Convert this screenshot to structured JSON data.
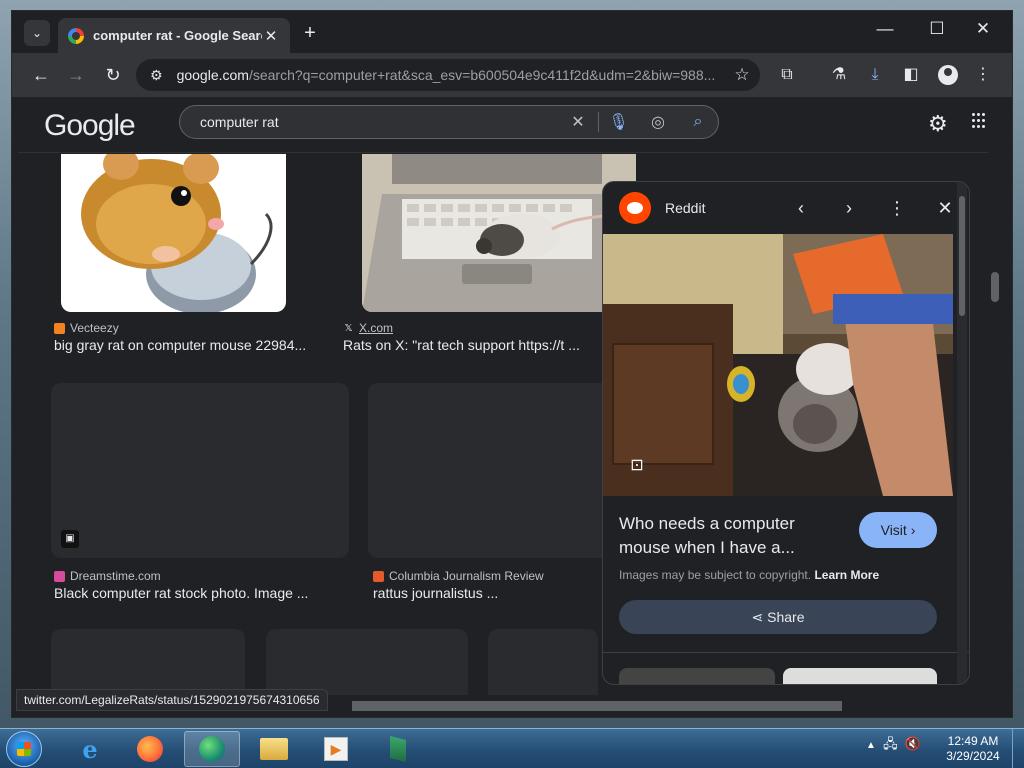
{
  "browser": {
    "tab_title": "computer rat - Google Search",
    "new_tab": "+",
    "url_domain": "google.com",
    "url_rest": "/search?q=computer+rat&sca_esv=b600504e9c411f2d&udm=2&biw=988..."
  },
  "google": {
    "logo": "Google",
    "query": "computer rat"
  },
  "results": [
    {
      "source": "Vecteezy",
      "title": "big gray rat on computer mouse 22984..."
    },
    {
      "source": "X.com",
      "title": "Rats on X: \"rat tech support https://t ..."
    },
    {
      "source": "Dreamstime.com",
      "title": "Black computer rat stock photo. Image ..."
    },
    {
      "source": "Columbia Journalism Review",
      "title": "rattus journalistus ..."
    }
  ],
  "panel": {
    "site": "Reddit",
    "title": "Who needs a computer mouse when I have a...",
    "visit": "Visit",
    "copyright": "Images may be subject to copyright.",
    "learn_more": "Learn More",
    "share": "Share"
  },
  "status_url": "twitter.com/LegalizeRats/status/1529021975674310656",
  "taskbar": {
    "time": "12:49 AM",
    "date": "3/29/2024"
  }
}
